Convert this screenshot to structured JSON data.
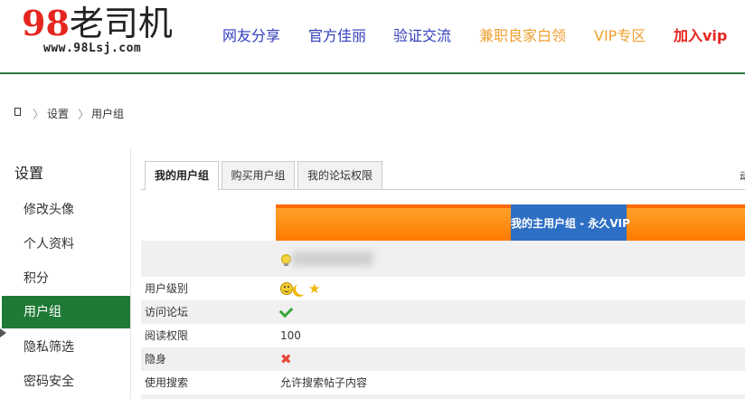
{
  "header": {
    "logo": {
      "num": "98",
      "text": "老司机",
      "url_text": "www.98Lsj.com"
    },
    "nav": [
      {
        "label": "网友分享",
        "color": "#2f3dbb"
      },
      {
        "label": "官方佳丽",
        "color": "#2f3dbb"
      },
      {
        "label": "验证交流",
        "color": "#2f3dbb"
      },
      {
        "label": "兼职良家白领",
        "color": "#f0a030"
      },
      {
        "label": "VIP专区",
        "color": "#f0a030"
      },
      {
        "label": "加入vip",
        "color": "#e5251f"
      }
    ]
  },
  "breadcrumb": {
    "home_icon": "home-icon",
    "items": [
      "设置",
      "用户组"
    ],
    "separator": "〉"
  },
  "sidebar": {
    "title": "设置",
    "items": [
      "修改头像",
      "个人资料",
      "积分",
      "用户组",
      "隐私筛选",
      "密码安全"
    ],
    "active_index": 3
  },
  "tabs": {
    "items": [
      "我的用户组",
      "购买用户组",
      "我的论坛权限"
    ],
    "active_index": 0,
    "edge_glyph": "动"
  },
  "group": {
    "title": "我的主用户组 - 永久VIP",
    "rows": [
      {
        "key": "用户级别",
        "icons": [
          "smile-icon",
          "moon-icon",
          "star-icon"
        ]
      },
      {
        "key": "访问论坛",
        "icon": "check-icon"
      },
      {
        "key": "阅读权限",
        "value": "100"
      },
      {
        "key": "隐身",
        "icon": "cross-icon"
      },
      {
        "key": "使用搜索",
        "value": "允许搜索帖子内容"
      }
    ]
  },
  "colors": {
    "accent_green": "#1f7a35",
    "band_orange": "#ff7a00",
    "title_blue": "#2d6fc4"
  }
}
